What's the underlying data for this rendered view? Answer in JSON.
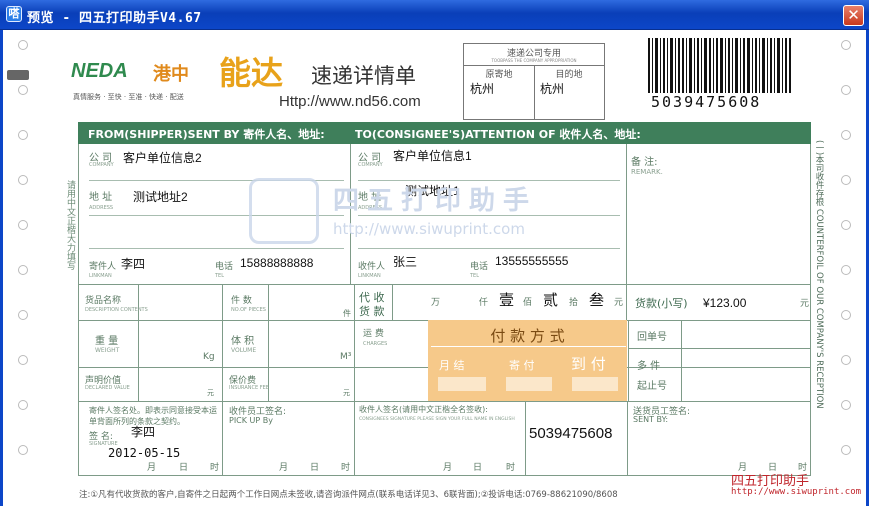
{
  "window": {
    "icon_char": "嗒",
    "title": "预览 - 四五打印助手V4.67",
    "close": "✕"
  },
  "logo": {
    "brand": "NEDA",
    "brand_cn": "港中",
    "nengda": "能达",
    "product": "速递详情单",
    "slogan": "真情服务 · 至快 · 至准 · 快递 · 配送",
    "url": "Http://www.nd56.com"
  },
  "company_box": {
    "title": "速递公司专用",
    "title_en": "TOOBPASS THE COMPANY APPROPRIATION",
    "origin_label": "原寄地",
    "dest_label": "目的地",
    "origin_value": "杭州",
    "dest_value": "杭州"
  },
  "barcode": {
    "number": "5039475608"
  },
  "header_bar": {
    "from": "FROM(SHIPPER)SENT BY 寄件人名、地址:",
    "to": "TO(CONSIGNEE'S)ATTENTION OF 收件人名、地址:"
  },
  "sender": {
    "company_label": "公 司",
    "company_en": "COMPANY",
    "company_value": "客户单位信息2",
    "address_label": "地 址",
    "address_en": "ADDRESS",
    "address_value": "测试地址2",
    "name_label": "寄件人",
    "name_en": "LINKMAN",
    "name_value": "李四",
    "phone_label": "电话",
    "phone_en": "TEL",
    "phone_value": "15888888888"
  },
  "receiver": {
    "company_label": "公 司",
    "company_en": "COMPANY",
    "company_value": "客户单位信息1",
    "address_label": "地 址",
    "address_en": "ADDRESS",
    "address_value": "测试地址1",
    "name_label": "收件人",
    "name_en": "LINKMAN",
    "name_value": "张三",
    "phone_label": "电话",
    "phone_en": "TEL",
    "phone_value": "13555555555"
  },
  "remark": {
    "label": "备 注:",
    "en": "REMARK."
  },
  "watermark": {
    "text": "四五打印助手",
    "url": "http://www.siwuprint.com"
  },
  "side": {
    "left_text": "请用中文正楷大力填写",
    "right_text": "(一)本司收件存根 COUNTERFOIL OF OUR COMPANY'S RECEPTION"
  },
  "goods": {
    "name_label": "货品名称",
    "name_en": "DESCRIPTION CONTENTS",
    "pieces_label": "件 数",
    "pieces_en": "NO.OF PIECES",
    "pieces_unit": "件",
    "cod_label1": "代 收",
    "cod_label2": "货 款",
    "units": [
      "万",
      "仟",
      "佰",
      "拾",
      "元"
    ],
    "amount_words": [
      "壹",
      "贰",
      "叁"
    ],
    "cod_amount_label": "货款(小写)",
    "cod_amount_value": "¥123.00",
    "cod_amount_unit": "元",
    "weight_label": "重 量",
    "weight_en": "WEIGHT",
    "weight_unit": "Kg",
    "volume_label": "体 积",
    "volume_en": "VOLUME",
    "volume_unit": "M³",
    "fee_label": "运 费",
    "fee_en": "CHARGES",
    "declared_label": "声明价值",
    "declared_en": "DECLARED VALUE",
    "declared_unit": "元",
    "insurance_label": "保价费",
    "insurance_en": "INSURANCE FEE",
    "insurance_unit": "元"
  },
  "payment": {
    "title": "付 款 方 式",
    "options": [
      "月 结",
      "寄 付",
      "到 付"
    ],
    "return_label": "回单号",
    "multi_label": "多 件",
    "range_label": "起止号"
  },
  "signatures": {
    "sender_sign": "寄件人签名处。即表示同意接受本运单背面所列的条款之契约。",
    "sender_sign2": "签 名:",
    "sender_sign_en": "SIGNATURE",
    "sender_sign_value": "李四",
    "sender_date": "2012-05-15",
    "pickup_label": "收件员工签名:",
    "pickup_en": "PICK UP By",
    "consignee_label": "收件人签名(请用中文正楷全名签收):",
    "consignee_en": "CONSIGNEES SIGNATURE PLEASE SIGN YOUR FULL NAME IN ENGLISH",
    "bottom_barcode": "5039475608",
    "delivery_label": "送货员工签名:",
    "delivery_en": "SENT BY:",
    "ymd": [
      "月",
      "日",
      "时"
    ]
  },
  "footer": {
    "note": "注:①凡有代收货款的客户,自寄件之日起两个工作日网点未签收,请咨询派件网点(联系电话详见3、6联背面);②投诉电话:0769-88621090/8608",
    "brand_stamp": "四五打印助手",
    "stamp_url": "http://www.siwuprint.com"
  }
}
